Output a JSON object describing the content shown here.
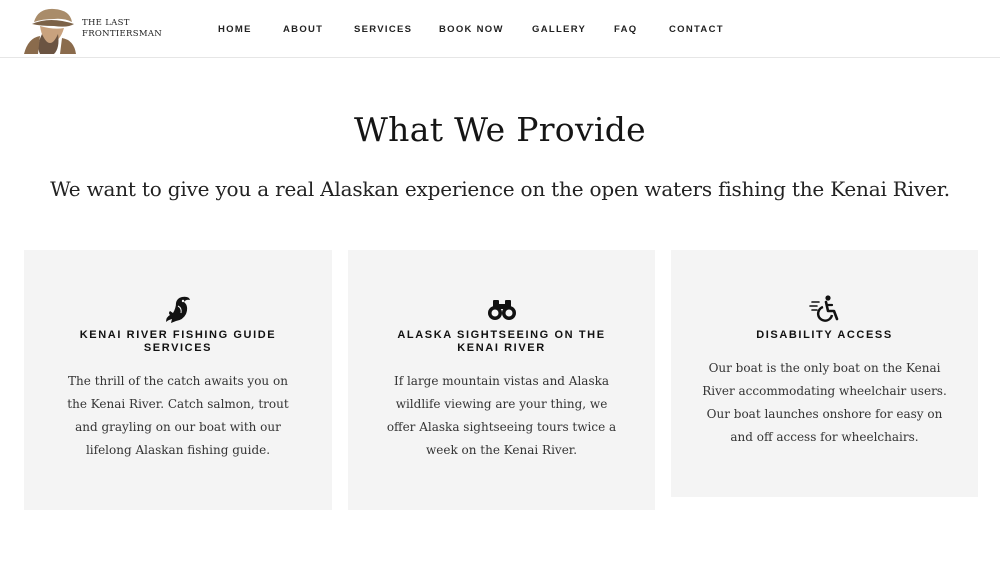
{
  "header": {
    "logo_text": "The Last Frontiersman",
    "nav": [
      {
        "label": "HOME"
      },
      {
        "label": "ABOUT"
      },
      {
        "label": "SERVICES"
      },
      {
        "label": "BOOK NOW"
      },
      {
        "label": "GALLERY"
      },
      {
        "label": "FAQ"
      },
      {
        "label": "CONTACT"
      }
    ]
  },
  "main": {
    "title": "What We Provide",
    "subtitle": "We want to give you a real Alaskan experience on the open waters fishing the Kenai River.",
    "cards": [
      {
        "icon": "fish-icon",
        "title": "KENAI RIVER FISHING GUIDE SERVICES",
        "text": "The thrill of the catch awaits you on the Kenai River. Catch salmon, trout and grayling on our boat with our lifelong Alaskan fishing guide."
      },
      {
        "icon": "binoculars-icon",
        "title": "ALASKA SIGHTSEEING ON THE KENAI RIVER",
        "text": "If large mountain vistas and Alaska wildlife viewing are your thing, we offer Alaska sightseeing tours twice a week on the Kenai River."
      },
      {
        "icon": "wheelchair-icon",
        "title": "DISABILITY ACCESS",
        "text": "Our boat is the only boat on the Kenai River accommodating wheelchair users. Our boat launches onshore for easy on and off access for wheelchairs."
      }
    ]
  }
}
